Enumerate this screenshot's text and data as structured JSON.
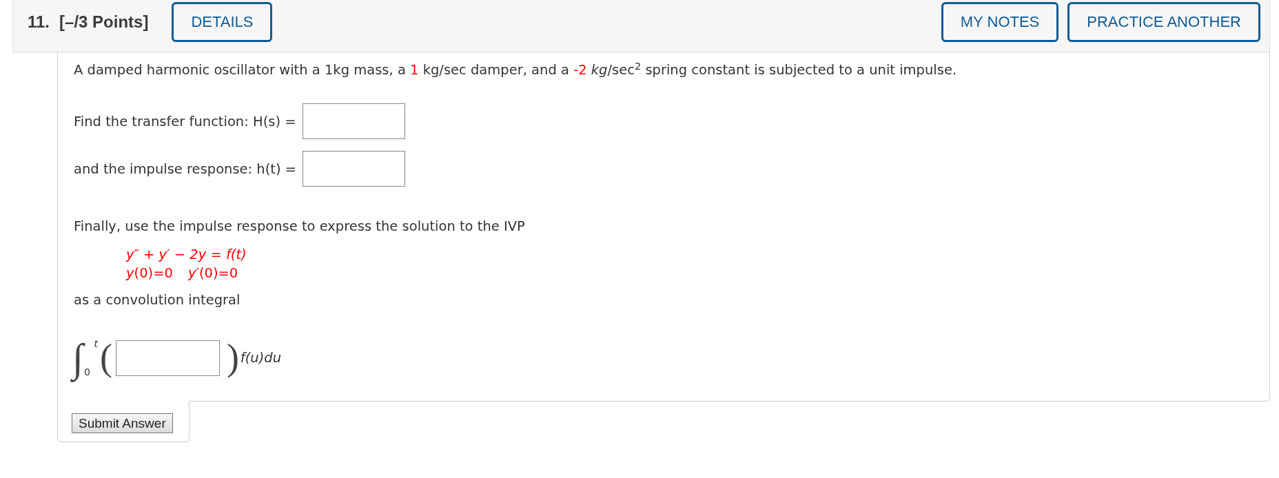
{
  "header": {
    "number": "11.",
    "points": "[–/3 Points]",
    "details_button": "DETAILS",
    "right_buttons": [
      "MY NOTES",
      "PRACTICE ANOTHER"
    ]
  },
  "question": {
    "segments": [
      {
        "kind": "text",
        "text": "A damped harmonic oscillator with a 1kg mass, a "
      },
      {
        "kind": "value",
        "text": "1"
      },
      {
        "kind": "text",
        "text": " kg/sec damper, and a "
      },
      {
        "kind": "value",
        "text": "-2"
      },
      {
        "kind": "text",
        "text": " *kg*/sec$^{2}$ spring constant is subjected to a unit impulse."
      }
    ]
  },
  "answers": [
    {
      "label": "Find the transfer function: H(s) ="
    },
    {
      "label": "and the impulse response: h(t) ="
    }
  ],
  "ivp": {
    "intro": "Finally, use the impulse response to express the solution to the IVP",
    "equation": "y″ + y′ − 2y = f(t)",
    "conditions": [
      "*y*(0)=0",
      "*y′*(0)=0"
    ],
    "outro": "as a convolution integral"
  },
  "integral": {
    "sign": "∫",
    "upper": "t",
    "lower": "0",
    "open": "(",
    "close": ")",
    "factor": "f(u)du"
  },
  "submit_button": "Submit Answer"
}
